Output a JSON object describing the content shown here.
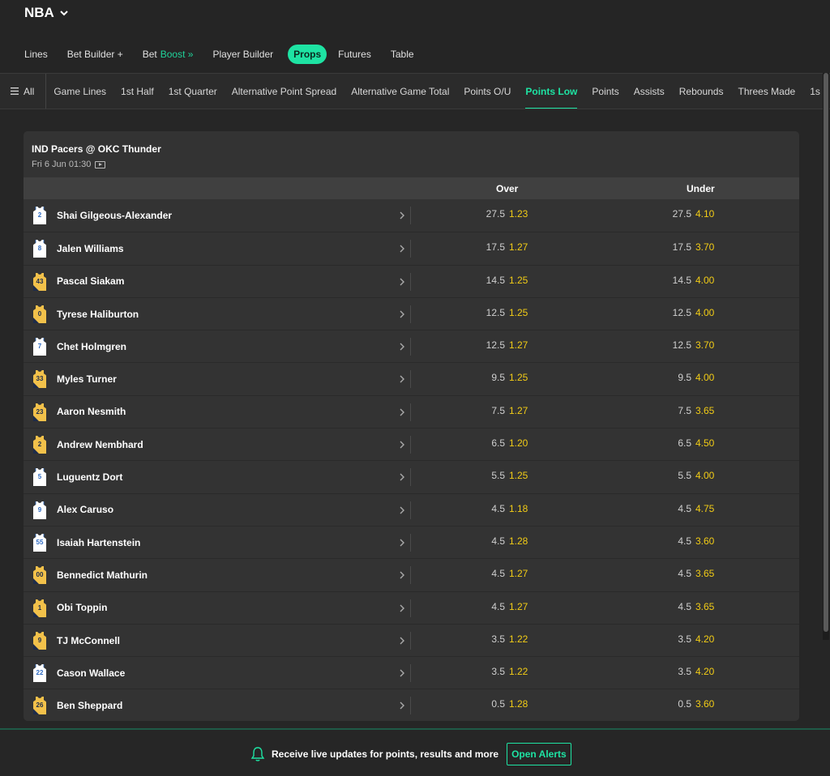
{
  "header": {
    "sport": "NBA"
  },
  "primary_nav": [
    {
      "label": "Lines"
    },
    {
      "label": "Bet Builder +"
    },
    {
      "label": "Bet",
      "accent": "Boost »"
    },
    {
      "label": "Player Builder"
    },
    {
      "label": "Props",
      "active": true
    },
    {
      "label": "Futures"
    },
    {
      "label": "Table"
    }
  ],
  "secondary_nav": {
    "all_label": "All",
    "items": [
      {
        "label": "Game Lines"
      },
      {
        "label": "1st Half"
      },
      {
        "label": "1st Quarter"
      },
      {
        "label": "Alternative Point Spread"
      },
      {
        "label": "Alternative Game Total"
      },
      {
        "label": "Points O/U"
      },
      {
        "label": "Points Low",
        "active": true
      },
      {
        "label": "Points"
      },
      {
        "label": "Assists"
      },
      {
        "label": "Rebounds"
      },
      {
        "label": "Threes Made"
      },
      {
        "label": "1s"
      }
    ]
  },
  "event": {
    "title": "IND Pacers @ OKC Thunder",
    "time": "Fri 6 Jun 01:30",
    "over_label": "Over",
    "under_label": "Under"
  },
  "players": [
    {
      "name": "Shai Gilgeous-Alexander",
      "number": "2",
      "team": "OKC",
      "over_line": "27.5",
      "over_price": "1.23",
      "under_line": "27.5",
      "under_price": "4.10"
    },
    {
      "name": "Jalen Williams",
      "number": "8",
      "team": "OKC",
      "over_line": "17.5",
      "over_price": "1.27",
      "under_line": "17.5",
      "under_price": "3.70"
    },
    {
      "name": "Pascal Siakam",
      "number": "43",
      "team": "IND",
      "over_line": "14.5",
      "over_price": "1.25",
      "under_line": "14.5",
      "under_price": "4.00"
    },
    {
      "name": "Tyrese Haliburton",
      "number": "0",
      "team": "IND",
      "over_line": "12.5",
      "over_price": "1.25",
      "under_line": "12.5",
      "under_price": "4.00"
    },
    {
      "name": "Chet Holmgren",
      "number": "7",
      "team": "OKC",
      "over_line": "12.5",
      "over_price": "1.27",
      "under_line": "12.5",
      "under_price": "3.70"
    },
    {
      "name": "Myles Turner",
      "number": "33",
      "team": "IND",
      "over_line": "9.5",
      "over_price": "1.25",
      "under_line": "9.5",
      "under_price": "4.00"
    },
    {
      "name": "Aaron Nesmith",
      "number": "23",
      "team": "IND",
      "over_line": "7.5",
      "over_price": "1.27",
      "under_line": "7.5",
      "under_price": "3.65"
    },
    {
      "name": "Andrew Nembhard",
      "number": "2",
      "team": "IND",
      "over_line": "6.5",
      "over_price": "1.20",
      "under_line": "6.5",
      "under_price": "4.50"
    },
    {
      "name": "Luguentz Dort",
      "number": "5",
      "team": "OKC",
      "over_line": "5.5",
      "over_price": "1.25",
      "under_line": "5.5",
      "under_price": "4.00"
    },
    {
      "name": "Alex Caruso",
      "number": "9",
      "team": "OKC",
      "over_line": "4.5",
      "over_price": "1.18",
      "under_line": "4.5",
      "under_price": "4.75"
    },
    {
      "name": "Isaiah Hartenstein",
      "number": "55",
      "team": "OKC",
      "over_line": "4.5",
      "over_price": "1.28",
      "under_line": "4.5",
      "under_price": "3.60"
    },
    {
      "name": "Bennedict Mathurin",
      "number": "00",
      "team": "IND",
      "over_line": "4.5",
      "over_price": "1.27",
      "under_line": "4.5",
      "under_price": "3.65"
    },
    {
      "name": "Obi Toppin",
      "number": "1",
      "team": "IND",
      "over_line": "4.5",
      "over_price": "1.27",
      "under_line": "4.5",
      "under_price": "3.65"
    },
    {
      "name": "TJ McConnell",
      "number": "9",
      "team": "IND",
      "over_line": "3.5",
      "over_price": "1.22",
      "under_line": "3.5",
      "under_price": "4.20"
    },
    {
      "name": "Cason Wallace",
      "number": "22",
      "team": "OKC",
      "over_line": "3.5",
      "over_price": "1.22",
      "under_line": "3.5",
      "under_price": "4.20"
    },
    {
      "name": "Ben Sheppard",
      "number": "26",
      "team": "IND",
      "over_line": "0.5",
      "over_price": "1.28",
      "under_line": "0.5",
      "under_price": "3.60"
    }
  ],
  "footer": {
    "message": "Receive live updates for points, results and more",
    "button_label": "Open Alerts"
  },
  "colors": {
    "accent": "#1ee3a3",
    "price": "#f2cc16",
    "okc_jersey": "#ffffff",
    "okc_trim": "#2f6bc2",
    "ind_jersey": "#f2c14a",
    "ind_trim": "#1d2b4a"
  },
  "icons": {
    "sport_dropdown": "chevron-down-icon",
    "menu": "hamburger-icon",
    "stream": "tv-play-icon",
    "row": "chevron-right-icon",
    "alerts": "bell-icon"
  }
}
